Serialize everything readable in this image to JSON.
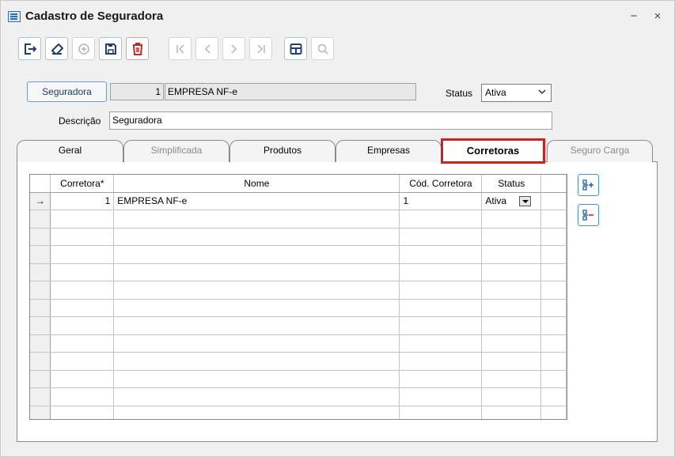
{
  "window": {
    "title": "Cadastro de Seguradora",
    "minimize_label": "−",
    "close_label": "×"
  },
  "toolbar": [
    {
      "name": "exit-icon",
      "enabled": true
    },
    {
      "name": "eraser-icon",
      "enabled": true
    },
    {
      "name": "add-circle-icon",
      "enabled": false
    },
    {
      "name": "save-icon",
      "enabled": true
    },
    {
      "name": "trash-icon",
      "enabled": true
    },
    {
      "name": "first-record-icon",
      "enabled": false
    },
    {
      "name": "previous-record-icon",
      "enabled": false
    },
    {
      "name": "next-record-icon",
      "enabled": false
    },
    {
      "name": "last-record-icon",
      "enabled": false
    },
    {
      "name": "table-icon",
      "enabled": true
    },
    {
      "name": "search-icon",
      "enabled": false
    }
  ],
  "form": {
    "seguradora_button": "Seguradora",
    "code": "1",
    "name": "EMPRESA NF-e",
    "status_label": "Status",
    "status_value": "Ativa",
    "descricao_label": "Descrição",
    "descricao_value": "Seguradora"
  },
  "tabs": [
    {
      "label": "Geral",
      "state": "normal"
    },
    {
      "label": "Simplificada",
      "state": "dim"
    },
    {
      "label": "Produtos",
      "state": "normal"
    },
    {
      "label": "Empresas",
      "state": "normal"
    },
    {
      "label": "Corretoras",
      "state": "active"
    },
    {
      "label": "Seguro Carga",
      "state": "dim"
    }
  ],
  "grid": {
    "columns": [
      "Corretora*",
      "Nome",
      "Cód. Corretora",
      "Status"
    ],
    "rows": [
      {
        "indicator": "→",
        "corretora": "1",
        "nome": "EMPRESA NF-e",
        "cod": "1",
        "status": "Ativa"
      }
    ],
    "empty_rows": 12
  },
  "side_buttons": [
    "add-row-icon",
    "remove-row-icon"
  ],
  "colors": {
    "accent": "#2a6fb8",
    "active_tab_border": "#d21f1f",
    "delete_red": "#c62828"
  }
}
